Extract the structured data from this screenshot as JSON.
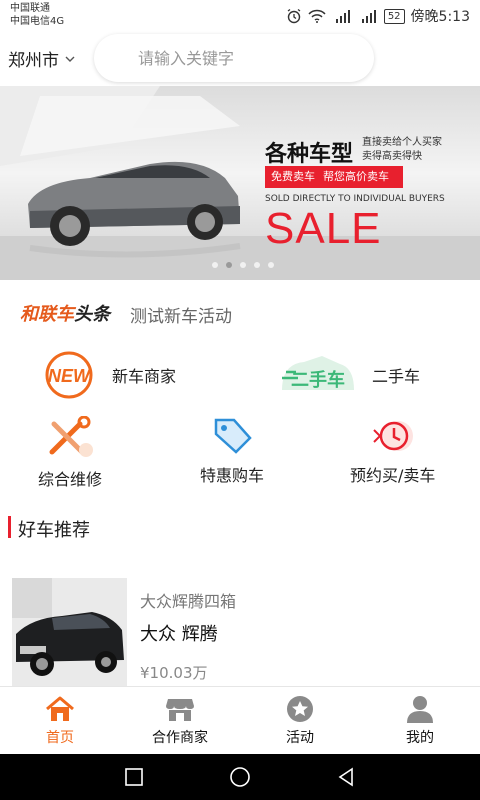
{
  "status_bar": {
    "carrier1": "中国联通",
    "carrier2": "中国电信4G",
    "battery": "52",
    "time": "傍晚5:13"
  },
  "header": {
    "city": "郑州市",
    "search_placeholder": "请输入关键字"
  },
  "banner": {
    "title": "各种车型",
    "sub1": "直接卖给个人买家",
    "sub2": "卖得高卖得快",
    "tag1": "免费卖车",
    "tag2": "帮您高价卖车",
    "english": "SOLD DIRECTLY TO INDIVIDUAL BUYERS",
    "sale": "SALE",
    "dot_count": 5,
    "active_dot": 1
  },
  "headline": {
    "brand_part1": "和联车",
    "brand_part2": "头条",
    "text": "测试新车活动"
  },
  "categories": [
    {
      "label": "新车商家",
      "icon": "new-badge-icon"
    },
    {
      "label": "二手车",
      "icon": "used-car-icon"
    },
    {
      "label": "综合维修",
      "icon": "repair-tools-icon"
    },
    {
      "label": "特惠购车",
      "icon": "price-tag-icon"
    },
    {
      "label": "预约买/卖车",
      "icon": "clock-icon"
    }
  ],
  "section": {
    "title": "好车推荐"
  },
  "car": {
    "subtitle": "大众辉腾四箱",
    "name": "大众 辉腾",
    "price": "¥10.03万"
  },
  "bottom_nav": [
    {
      "label": "首页",
      "icon": "home-icon",
      "active": true
    },
    {
      "label": "合作商家",
      "icon": "store-icon",
      "active": false
    },
    {
      "label": "活动",
      "icon": "star-icon",
      "active": false
    },
    {
      "label": "我的",
      "icon": "person-icon",
      "active": false
    }
  ],
  "colors": {
    "accent": "#f06a1d",
    "red": "#e8202e",
    "green": "#3cb878",
    "blue": "#2e8fd8"
  }
}
